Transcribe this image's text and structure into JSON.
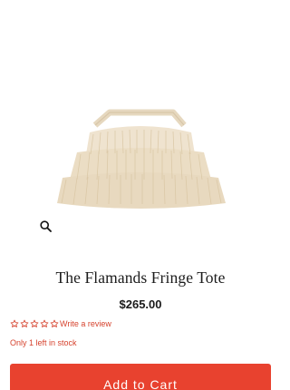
{
  "product": {
    "title": "The Flamands Fringe Tote",
    "price": "$265.00",
    "image_icon": "fringe-tote-bag-image",
    "zoom_icon": "magnifier-icon"
  },
  "rating": {
    "stars_filled": 0,
    "stars_total": 5,
    "review_link": "Write a review"
  },
  "stock": {
    "message": "Only 1 left in stock"
  },
  "actions": {
    "add_to_cart": "Add to Cart"
  },
  "colors": {
    "accent": "#e8422f",
    "accent_text": "#d6432e",
    "text": "#1a1a1a"
  }
}
